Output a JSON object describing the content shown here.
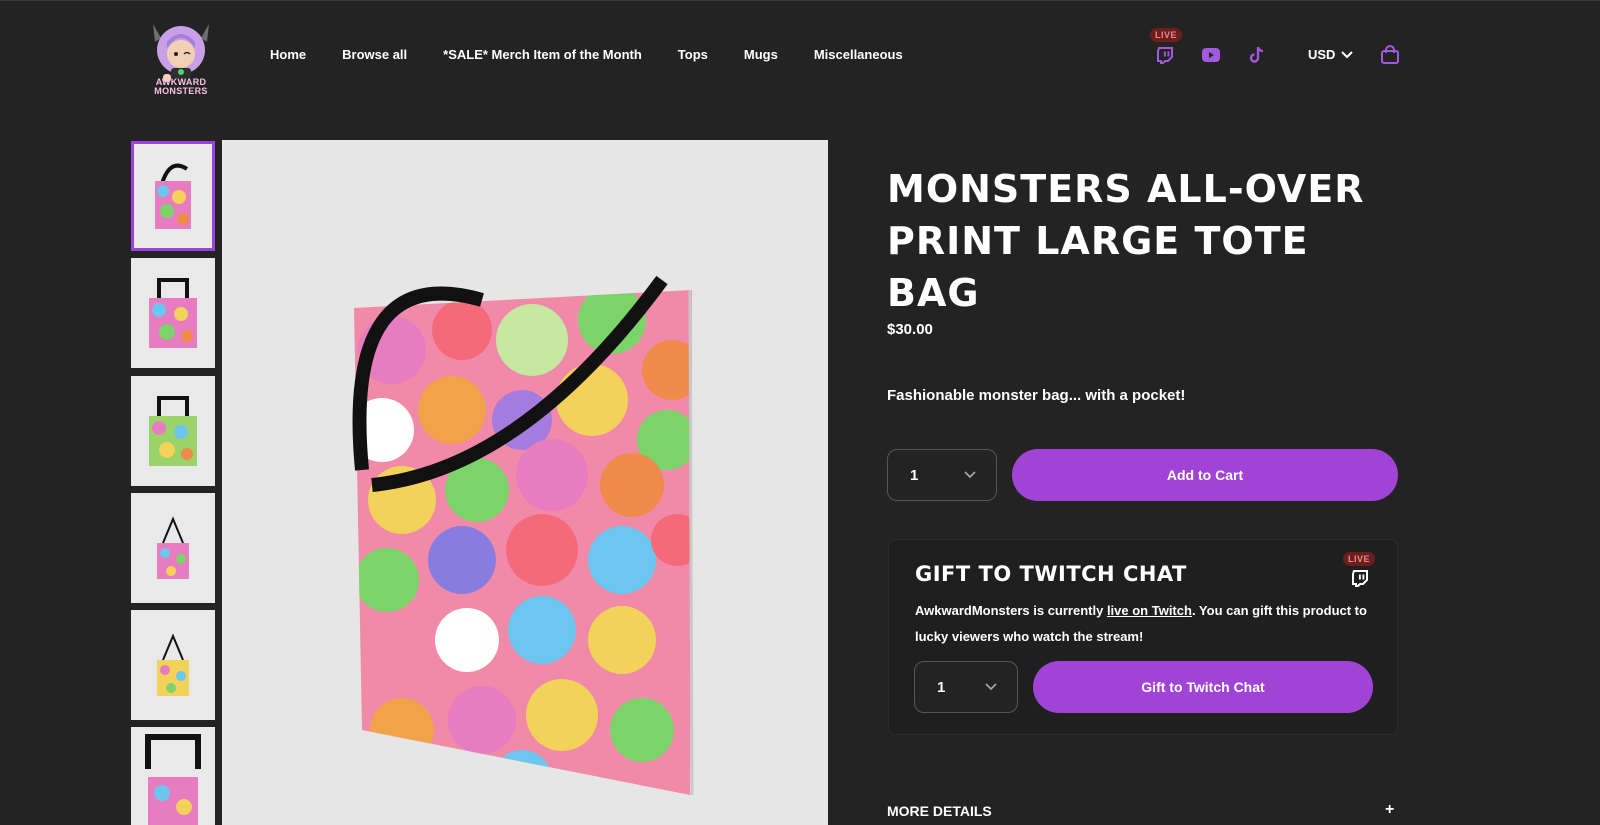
{
  "brand": {
    "logo_text": "AWKWARD MONSTERS"
  },
  "nav": {
    "items": [
      {
        "label": "Home"
      },
      {
        "label": "Browse all"
      },
      {
        "label": "*SALE* Merch Item of the Month"
      },
      {
        "label": "Tops"
      },
      {
        "label": "Mugs"
      },
      {
        "label": "Miscellaneous"
      }
    ]
  },
  "header": {
    "live_badge": "LIVE",
    "currency": "USD",
    "icons": [
      "twitch-icon",
      "youtube-icon",
      "tiktok-icon",
      "shopping-bag-icon"
    ]
  },
  "product": {
    "title": "Monsters All-Over Print Large Tote Bag",
    "price": "$30.00",
    "description": "Fashionable monster bag... with a pocket!",
    "quantity": "1",
    "add_to_cart_label": "Add to Cart",
    "thumbnail_count": 6,
    "selected_thumbnail": 1
  },
  "gift": {
    "title": "Gift to Twitch Chat",
    "live_badge": "LIVE",
    "text_before": "AwkwardMonsters is currently ",
    "link_text": "live on Twitch",
    "text_after": ". You can gift this product to lucky viewers who watch the stream!",
    "quantity": "1",
    "button_label": "Gift to Twitch Chat"
  },
  "details": {
    "label": "More Details",
    "toggle": "+"
  },
  "colors": {
    "accent": "#a144d6",
    "background": "#232323",
    "icon_purple": "#a259e0"
  }
}
